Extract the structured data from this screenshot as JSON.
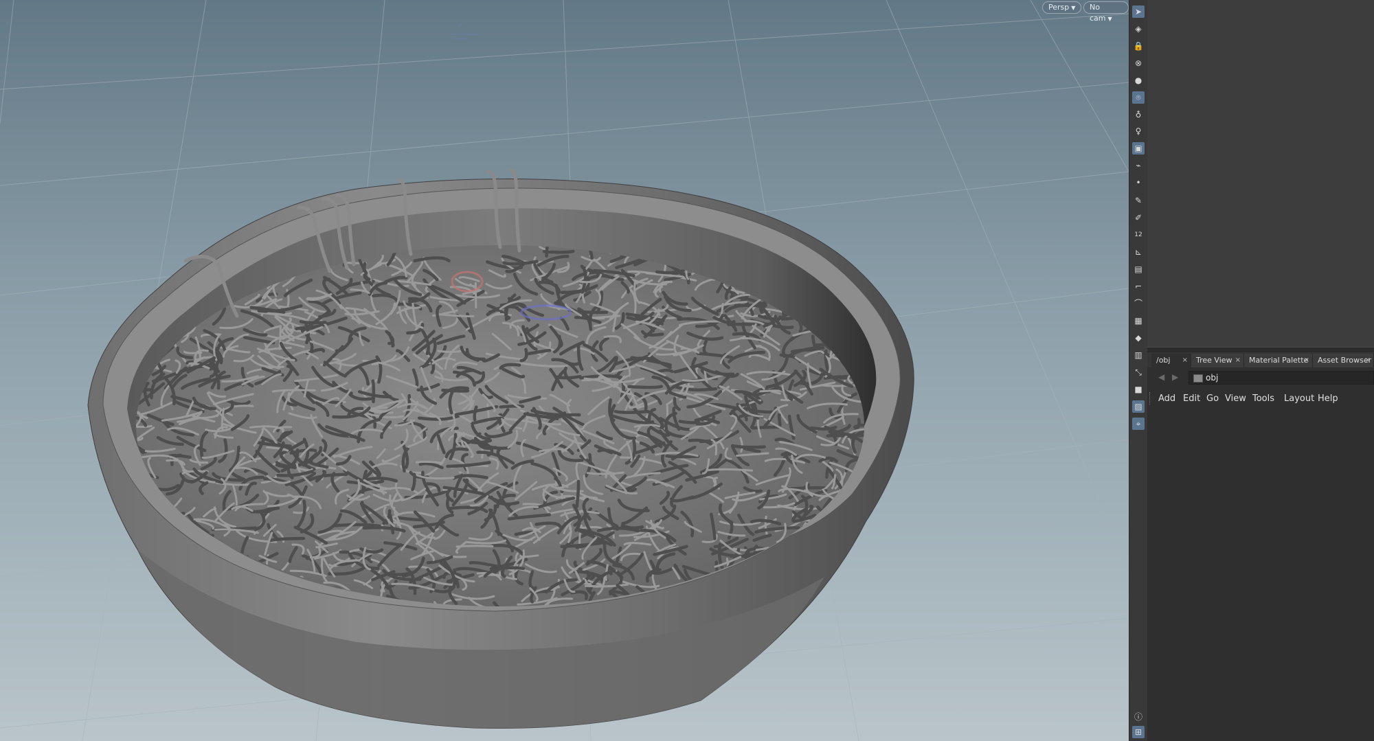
{
  "viewport": {
    "camera_view_label": "Persp",
    "camera_label": "No cam"
  },
  "shelf": {
    "tools": [
      {
        "icon": "select-arrow-icon"
      },
      {
        "icon": "ghost-icon"
      },
      {
        "icon": "lock-icon"
      },
      {
        "icon": "no-select-icon"
      },
      {
        "icon": "sphere-icon"
      },
      {
        "icon": "magnet-pin-icon"
      },
      {
        "icon": "light-bulb-icon"
      },
      {
        "icon": "light-alt-icon"
      },
      {
        "icon": "display-mode-icon"
      },
      {
        "icon": "vertex-icon"
      },
      {
        "icon": "point-icon"
      },
      {
        "icon": "paint-icon"
      },
      {
        "icon": "brush-icon"
      },
      {
        "icon": "number-icon"
      },
      {
        "icon": "axis-icon"
      },
      {
        "icon": "box-icon"
      },
      {
        "icon": "corner-icon"
      },
      {
        "icon": "hat-icon"
      },
      {
        "icon": "checker-icon"
      },
      {
        "icon": "dot-gear-icon"
      },
      {
        "icon": "ground-icon"
      },
      {
        "icon": "scale-icon"
      },
      {
        "icon": "square-icon"
      },
      {
        "icon": "screenshot-icon"
      },
      {
        "icon": "pin-icon"
      },
      {
        "icon": "info-icon"
      },
      {
        "icon": "grid-icon"
      }
    ],
    "number_glyph": "12"
  },
  "panes": {
    "tabs": [
      {
        "label": "/obj"
      },
      {
        "label": "Tree View"
      },
      {
        "label": "Material Palette"
      },
      {
        "label": "Asset Browser"
      }
    ],
    "path_value": "obj",
    "menu": [
      "Add",
      "Edit",
      "Go",
      "View",
      "Tools",
      "Layout",
      "Help"
    ]
  },
  "colors": {
    "accent": "#5b7590",
    "viewport_top": "#6a7f8c",
    "viewport_bottom": "#b6c2c8"
  }
}
